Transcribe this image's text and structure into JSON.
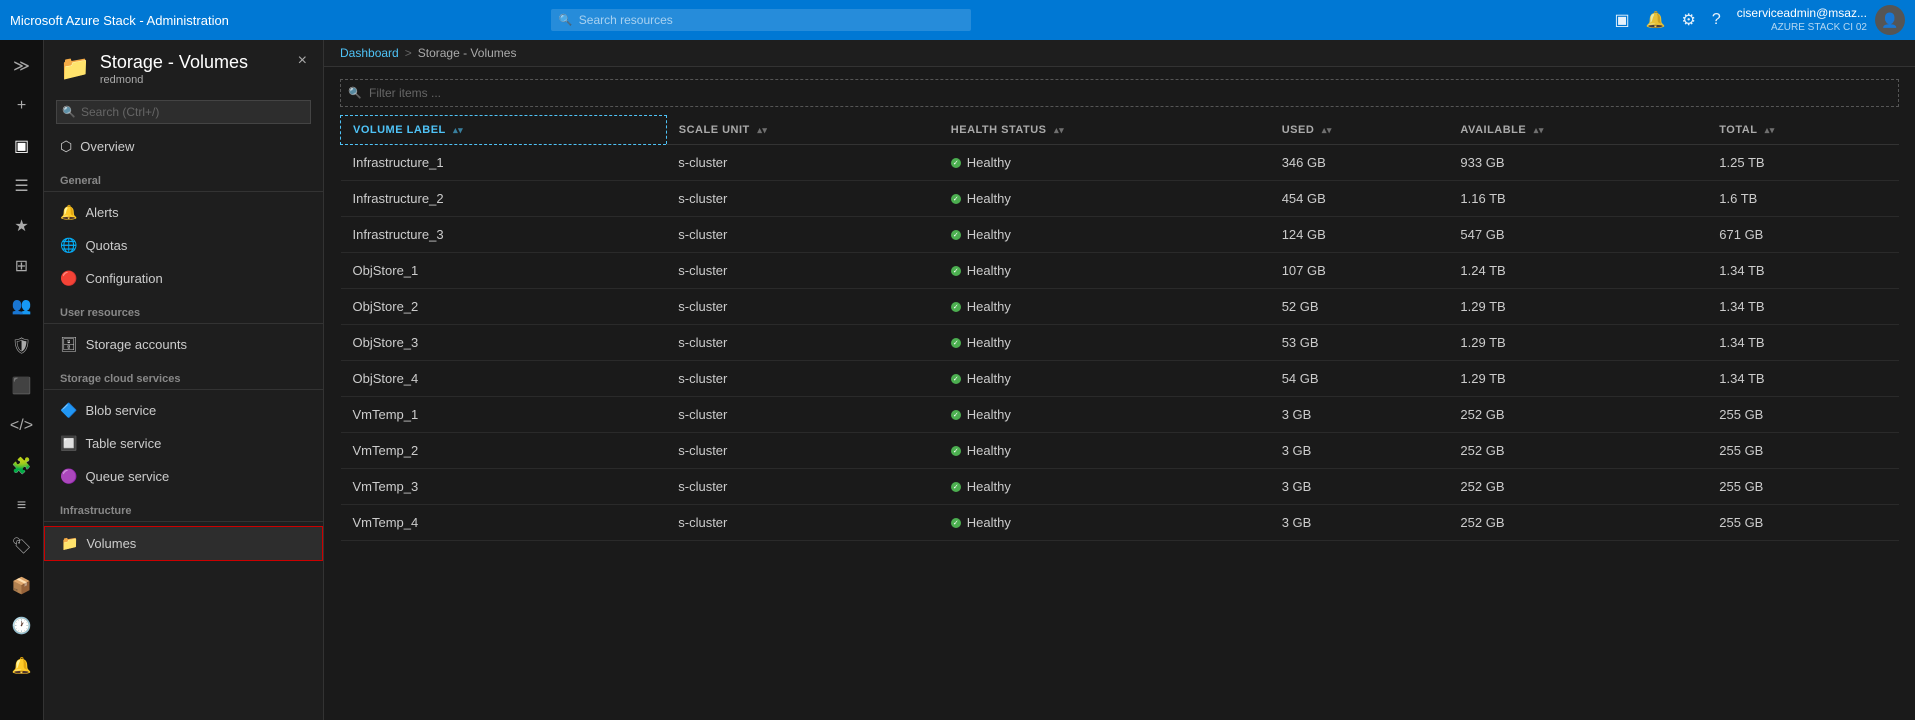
{
  "app": {
    "title": "Microsoft Azure Stack - Administration"
  },
  "topbar": {
    "title": "Microsoft Azure Stack - Administration",
    "search_placeholder": "Search resources",
    "user_name": "ciserviceadmin@msaz...",
    "user_sub": "AZURE STACK CI 02"
  },
  "breadcrumb": {
    "dashboard": "Dashboard",
    "separator": ">",
    "current": "Storage - Volumes"
  },
  "page_header": {
    "title": "Storage - Volumes",
    "subtitle": "redmond",
    "close_label": "×"
  },
  "sidebar": {
    "search_placeholder": "Search (Ctrl+/)",
    "collapse_icon": "«",
    "overview_label": "Overview",
    "general_section": "General",
    "alerts_label": "Alerts",
    "quotas_label": "Quotas",
    "configuration_label": "Configuration",
    "user_resources_section": "User resources",
    "storage_accounts_label": "Storage accounts",
    "storage_cloud_section": "Storage cloud services",
    "blob_service_label": "Blob service",
    "table_service_label": "Table service",
    "queue_service_label": "Queue service",
    "infrastructure_section": "Infrastructure",
    "volumes_label": "Volumes"
  },
  "filter": {
    "placeholder": "Filter items ..."
  },
  "table": {
    "columns": [
      {
        "key": "volume_label",
        "label": "VOLUME LABEL"
      },
      {
        "key": "scale_unit",
        "label": "SCALE UNIT"
      },
      {
        "key": "health_status",
        "label": "HEALTH STATUS"
      },
      {
        "key": "used",
        "label": "USED"
      },
      {
        "key": "available",
        "label": "AVAILABLE"
      },
      {
        "key": "total",
        "label": "TOTAL"
      }
    ],
    "rows": [
      {
        "volume_label": "Infrastructure_1",
        "scale_unit": "s-cluster",
        "health_status": "Healthy",
        "used": "346 GB",
        "available": "933 GB",
        "total": "1.25 TB"
      },
      {
        "volume_label": "Infrastructure_2",
        "scale_unit": "s-cluster",
        "health_status": "Healthy",
        "used": "454 GB",
        "available": "1.16 TB",
        "total": "1.6 TB"
      },
      {
        "volume_label": "Infrastructure_3",
        "scale_unit": "s-cluster",
        "health_status": "Healthy",
        "used": "124 GB",
        "available": "547 GB",
        "total": "671 GB"
      },
      {
        "volume_label": "ObjStore_1",
        "scale_unit": "s-cluster",
        "health_status": "Healthy",
        "used": "107 GB",
        "available": "1.24 TB",
        "total": "1.34 TB"
      },
      {
        "volume_label": "ObjStore_2",
        "scale_unit": "s-cluster",
        "health_status": "Healthy",
        "used": "52 GB",
        "available": "1.29 TB",
        "total": "1.34 TB"
      },
      {
        "volume_label": "ObjStore_3",
        "scale_unit": "s-cluster",
        "health_status": "Healthy",
        "used": "53 GB",
        "available": "1.29 TB",
        "total": "1.34 TB"
      },
      {
        "volume_label": "ObjStore_4",
        "scale_unit": "s-cluster",
        "health_status": "Healthy",
        "used": "54 GB",
        "available": "1.29 TB",
        "total": "1.34 TB"
      },
      {
        "volume_label": "VmTemp_1",
        "scale_unit": "s-cluster",
        "health_status": "Healthy",
        "used": "3 GB",
        "available": "252 GB",
        "total": "255 GB"
      },
      {
        "volume_label": "VmTemp_2",
        "scale_unit": "s-cluster",
        "health_status": "Healthy",
        "used": "3 GB",
        "available": "252 GB",
        "total": "255 GB"
      },
      {
        "volume_label": "VmTemp_3",
        "scale_unit": "s-cluster",
        "health_status": "Healthy",
        "used": "3 GB",
        "available": "252 GB",
        "total": "255 GB"
      },
      {
        "volume_label": "VmTemp_4",
        "scale_unit": "s-cluster",
        "health_status": "Healthy",
        "used": "3 GB",
        "available": "252 GB",
        "total": "255 GB"
      }
    ]
  },
  "icons": {
    "search": "🔍",
    "bell": "🔔",
    "gear": "⚙",
    "question": "?",
    "folder": "📁",
    "overview": "⬡",
    "alerts": "🔔",
    "quotas": "🌐",
    "configuration": "🔴",
    "storage": "🗄",
    "blob": "🔷",
    "table": "🔲",
    "queue": "🟣",
    "volumes": "📁",
    "chevron_down": "▾",
    "chevron_up": "▴",
    "collapse": "«",
    "portal": "▣",
    "feedback": "💬",
    "plus": "+"
  }
}
